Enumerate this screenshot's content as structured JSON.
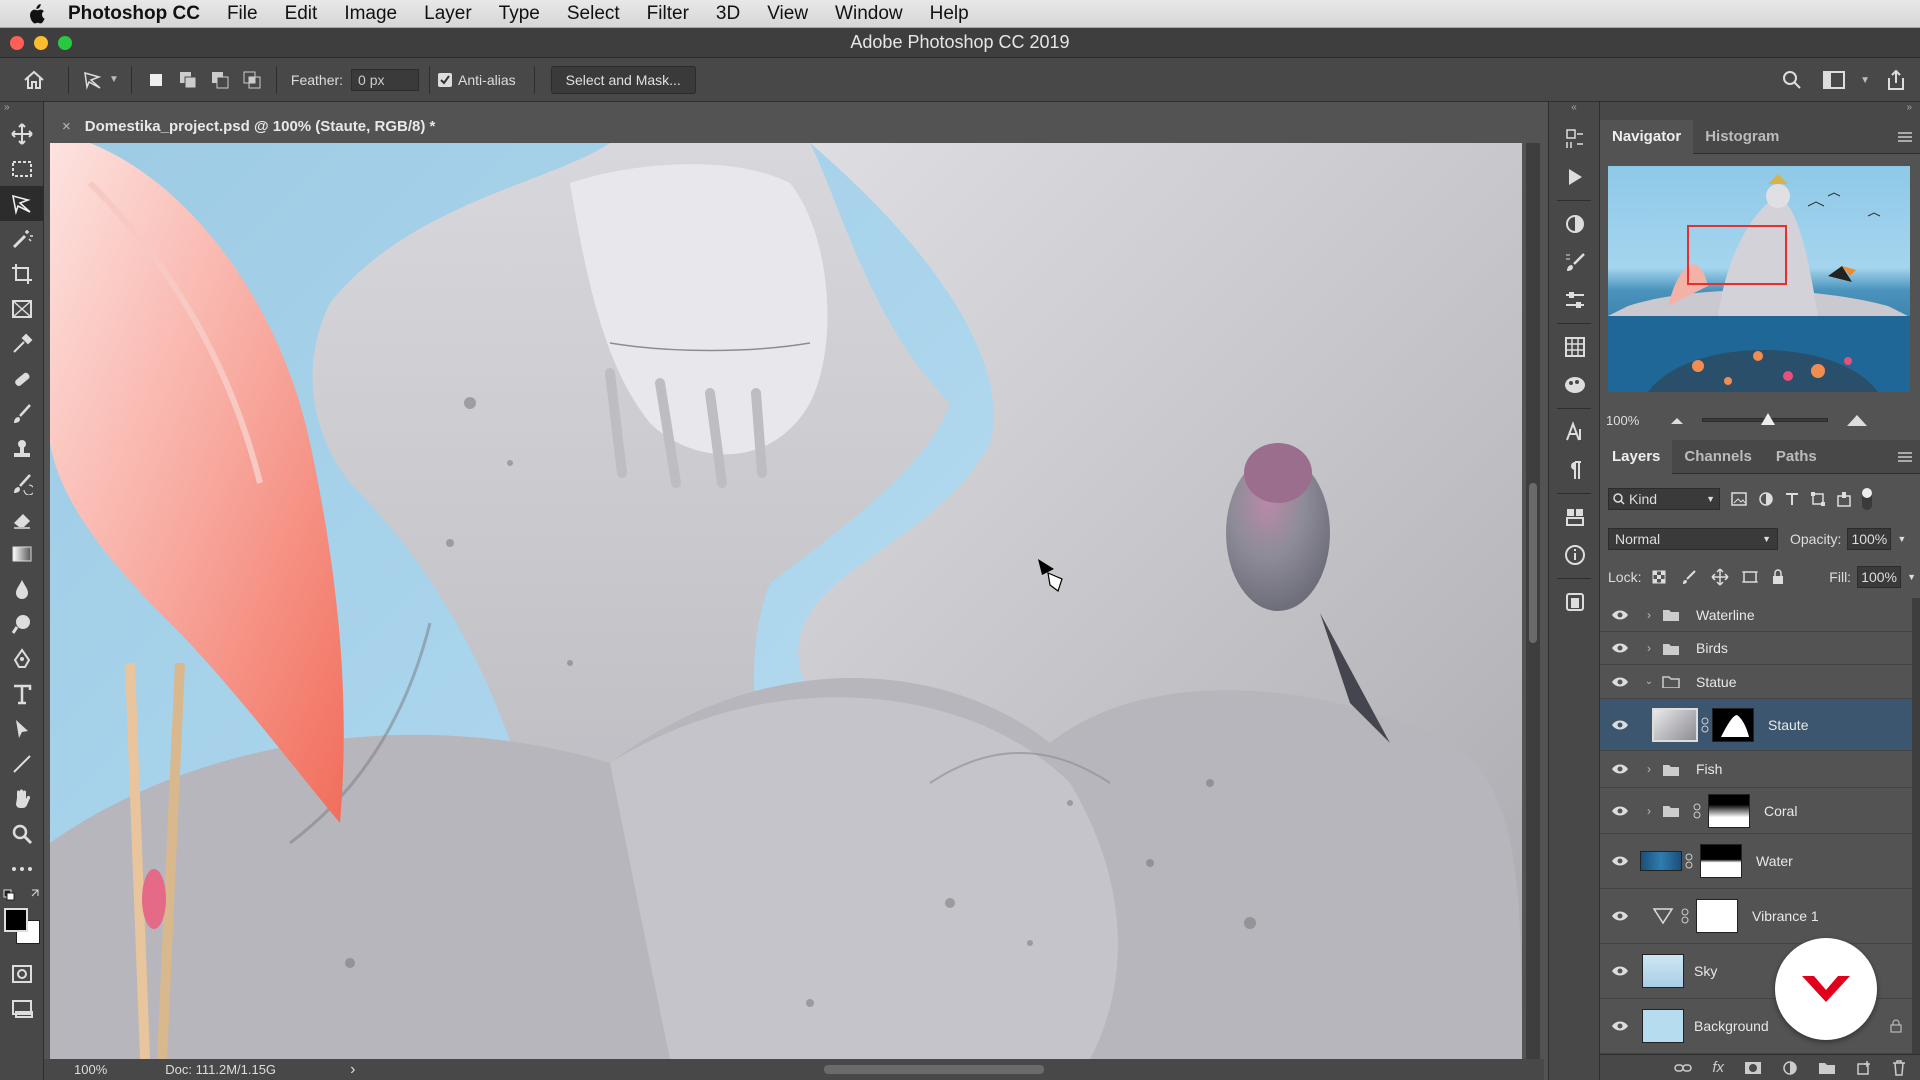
{
  "menubar": {
    "app_name": "Photoshop CC",
    "items": [
      "File",
      "Edit",
      "Image",
      "Layer",
      "Type",
      "Select",
      "Filter",
      "3D",
      "View",
      "Window",
      "Help"
    ]
  },
  "window": {
    "title": "Adobe Photoshop CC 2019"
  },
  "options_bar": {
    "feather_label": "Feather:",
    "feather_value": "0 px",
    "antialias_label": "Anti-alias",
    "antialias_checked": true,
    "select_mask_label": "Select and Mask..."
  },
  "document": {
    "tab_title": "Domestika_project.psd @ 100% (Staute, RGB/8) *",
    "close_glyph": "×"
  },
  "status_bar": {
    "zoom": "100%",
    "doc": "Doc: 111.2M/1.15G",
    "arrow": "›"
  },
  "navigator": {
    "tabs": [
      "Navigator",
      "Histogram"
    ],
    "zoom": "100%"
  },
  "layers_panel": {
    "tabs": [
      "Layers",
      "Channels",
      "Paths"
    ],
    "filter_kind": "Kind",
    "blend_mode": "Normal",
    "opacity_label": "Opacity:",
    "opacity": "100%",
    "lock_label": "Lock:",
    "fill_label": "Fill:",
    "fill": "100%",
    "layers": [
      {
        "name": "Waterline",
        "type": "group",
        "expanded": false
      },
      {
        "name": "Birds",
        "type": "group",
        "expanded": false
      },
      {
        "name": "Statue",
        "type": "group",
        "expanded": true
      },
      {
        "name": "Staute",
        "type": "layer-mask",
        "selected": true
      },
      {
        "name": "Fish",
        "type": "group",
        "expanded": false
      },
      {
        "name": "Coral",
        "type": "group-mask",
        "expanded": false
      },
      {
        "name": "Water",
        "type": "layer-mask"
      },
      {
        "name": "Vibrance 1",
        "type": "adjustment"
      },
      {
        "name": "Sky",
        "type": "layer"
      },
      {
        "name": "Background",
        "type": "layer",
        "locked": true
      }
    ]
  },
  "colors": {
    "accent_selected": "#3c5670",
    "logo_red": "#e0001b"
  }
}
